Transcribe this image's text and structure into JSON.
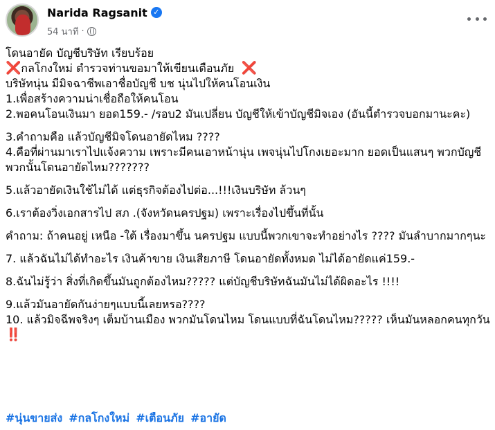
{
  "post": {
    "author": "Narida Ragsanit",
    "timestamp": "54 นาที",
    "dot": "·",
    "icons": {
      "verified": "verified-badge-icon",
      "audience": "globe-icon",
      "more": "more-options-icon",
      "cross": "cross-mark-icon",
      "alert": "double-exclamation-icon"
    },
    "lines": {
      "l1": "โดนอายัด บัญชีบริษัท เรียบร้อย",
      "l2": "กลโกงใหม่  ตำรวจท่านขอมาให้เขียนเตือนภัย",
      "l3": "บริษัทนุ่น มีมิจฉาชีพเอาชื่อบัญชี บช นุ่นไปให้คนโอนเงิน",
      "l4": "1.เพื่อสร้างความน่าเชื่อถือให้คนโอน",
      "l5": "2.พอคนโอนเงินมา ยอด159.- /รอบ2 มันเปลี่ยน บัญชีให้เข้าบัญชีมิจเอง (อันนี้ตำรวจบอกมานะคะ)",
      "l6": "3.คำถามคือ แล้วบัญชีมิจโดนอายัดไหม ????",
      "l7": "4.คือที่ผ่านมาเราไปแจ้งความ เพราะมีคนเอาหน้านุ่น เพจนุ่นไปโกงเยอะมาก  ยอดเป็นแสนๆ พวกบัญชีพวกนั้นโดนอายัดไหม???????",
      "l8": "5.แล้วอายัดเงินใช้ไม่ได้ แต่ธุรกิจต้องไปต่อ...!!!เงินบริษัท ล้วนๆ",
      "l9": "6.เราต้องวิ่งเอกสารไป สภ .(จังหวัดนครปฐม) เพราะเรื่องไปขึ้นที่นั้น",
      "l10": "คำถาม: ถ้าคนอยู่ เหนือ -ใต้  เรื่องมาขึ้น นครปฐม แบบนี้พวกเขาจะทำอย่างไร  ????   มันลำบากมากๆนะ",
      "l11": "7. แล้วฉันไม่ได้ทำอะไร เงินค้าขาย เงินเสียภาษี  โดนอายัดทั้งหมด  ไม่ได้อายัดแค่159.-",
      "l12": "8.ฉันไม่รู้ว่า สิ่งที่เกิดขึ้นมันถูกต้องไหม????? แต่บัญชีบริษัทฉันมันไม่ได้ผิดอะไร  !!!!",
      "l13": "9.แล้วมันอายัดกันง่ายๆแบบนี้เลยหรอ????",
      "l14": "10. แล้วมิจฉีพจริงๆ เต็มบ้านเมือง  พวกมันโดนไหม โดนแบบที่ฉันโดนไหม????? เห็นมันหลอกคนทุกวัน"
    },
    "glyphs": {
      "cross": "❌",
      "alert": "‼️"
    },
    "hashtags": [
      "#นุ่นขายส่ง",
      "#กลโกงใหม่",
      "#เตือนภัย",
      "#อายัด"
    ]
  },
  "colors": {
    "text": "#050505",
    "meta": "#65676b",
    "hashtag": "#1b74e4",
    "verified": "#1877f2",
    "cross": "#d93025"
  }
}
